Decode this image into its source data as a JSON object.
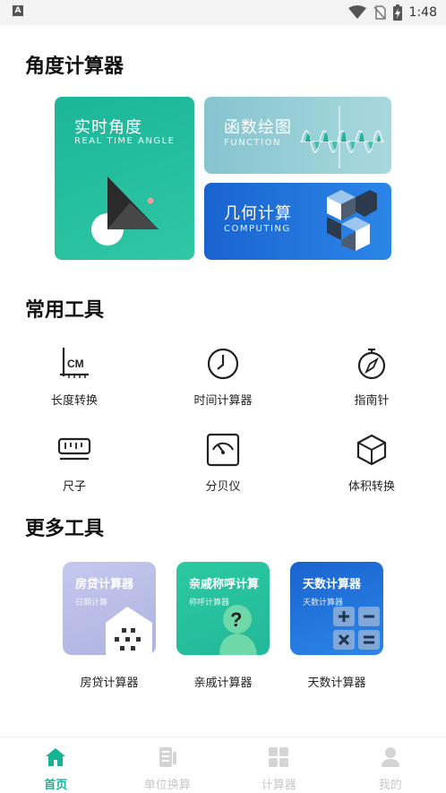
{
  "status_bar": {
    "time": "1:48",
    "notification_icon": "a-icon"
  },
  "sections": {
    "angle": "角度计算器",
    "common": "常用工具",
    "more": "更多工具"
  },
  "angle_cards": {
    "realtime": {
      "title": "实时角度",
      "subtitle": "REAL TIME ANGLE"
    },
    "function": {
      "title": "函数绘图",
      "subtitle": "FUNCTION"
    },
    "geometry": {
      "title": "几何计算",
      "subtitle": "COMPUTING"
    }
  },
  "common_tools": [
    {
      "label": "长度转换",
      "icon": "ruler-cm-icon"
    },
    {
      "label": "时间计算器",
      "icon": "clock-icon"
    },
    {
      "label": "指南针",
      "icon": "compass-icon"
    },
    {
      "label": "尺子",
      "icon": "ruler-icon"
    },
    {
      "label": "分贝仪",
      "icon": "decibel-meter-icon"
    },
    {
      "label": "体积转换",
      "icon": "cube-icon"
    }
  ],
  "more_tools": [
    {
      "title": "房贷计算器",
      "subtitle": "日期计算",
      "label": "房贷计算器",
      "color": "#b7bde6"
    },
    {
      "title": "亲戚称呼计算",
      "subtitle": "称呼计算器",
      "label": "亲戚计算器",
      "color": "#2bc59d"
    },
    {
      "title": "天数计算器",
      "subtitle": "天数计算器",
      "label": "天数计算器",
      "color": "#1d6fd6"
    }
  ],
  "nav": [
    {
      "label": "首页",
      "active": true,
      "icon": "home-icon"
    },
    {
      "label": "单位换算",
      "active": false,
      "icon": "convert-icon"
    },
    {
      "label": "计算器",
      "active": false,
      "icon": "calculator-icon"
    },
    {
      "label": "我的",
      "active": false,
      "icon": "profile-icon"
    }
  ],
  "colors": {
    "accent": "#17b394",
    "inactive": "#c8c8c8"
  }
}
